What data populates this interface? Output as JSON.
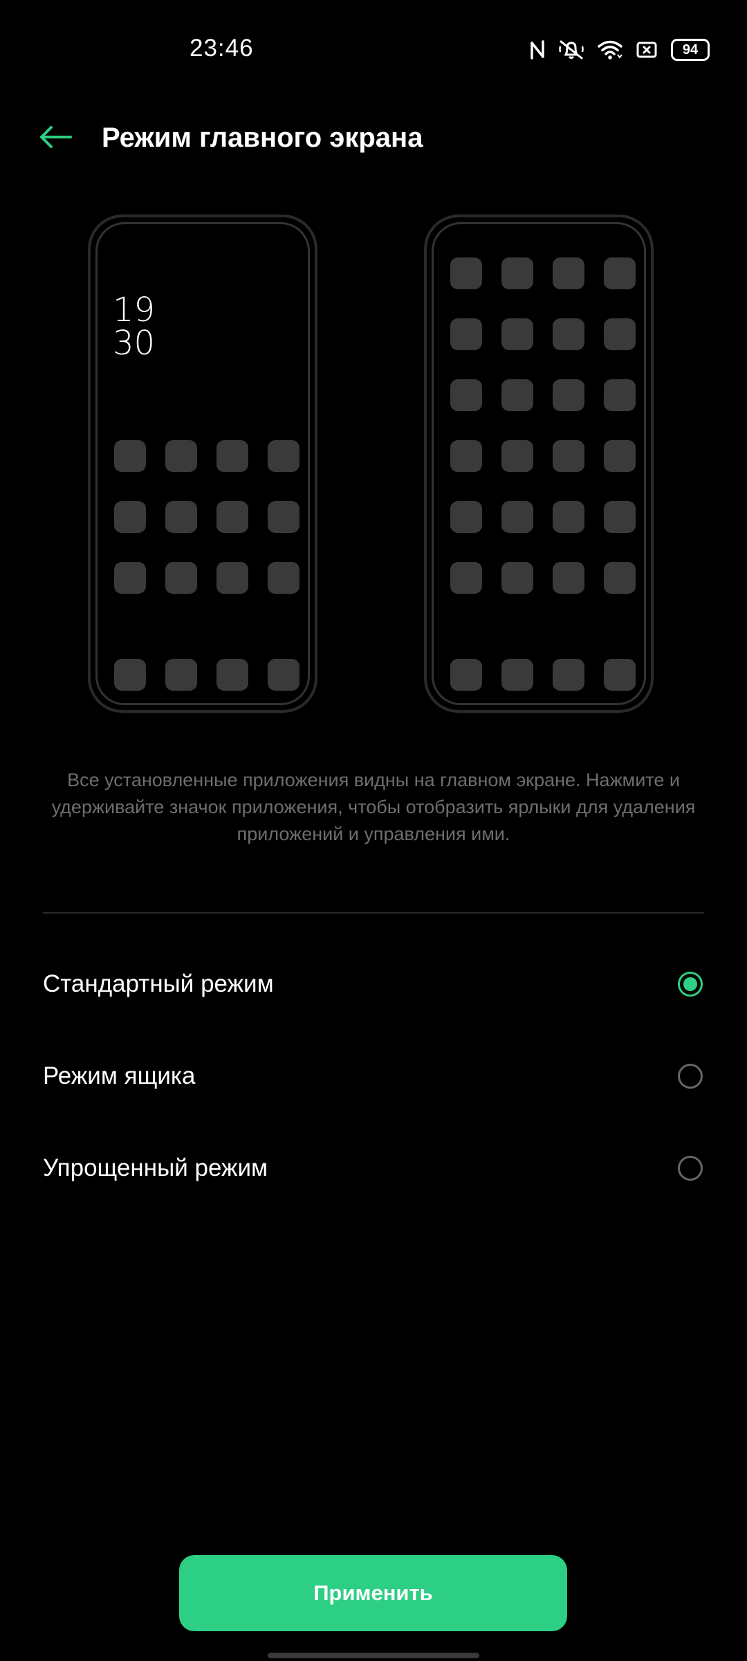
{
  "status_bar": {
    "time": "23:46",
    "battery": "94",
    "icons": [
      "nfc-icon",
      "silent-bell-icon",
      "wifi-icon",
      "screen-record-icon",
      "battery-icon"
    ]
  },
  "header": {
    "back_icon": "arrow-left-icon",
    "title": "Режим главного экрана"
  },
  "preview": {
    "clock_hours": "19",
    "clock_minutes": "30"
  },
  "description": "Все установленные приложения видны на главном экране. Нажмите и удерживайте значок приложения, чтобы отобразить ярлыки для удаления приложений и управления ими.",
  "options": [
    {
      "label": "Стандартный режим",
      "selected": true
    },
    {
      "label": "Режим ящика",
      "selected": false
    },
    {
      "label": "Упрощенный режим",
      "selected": false
    }
  ],
  "apply_label": "Применить",
  "colors": {
    "accent": "#2dcf84",
    "background": "#000000",
    "description_text": "#6e6e6e",
    "tile": "#3a3a3a"
  }
}
